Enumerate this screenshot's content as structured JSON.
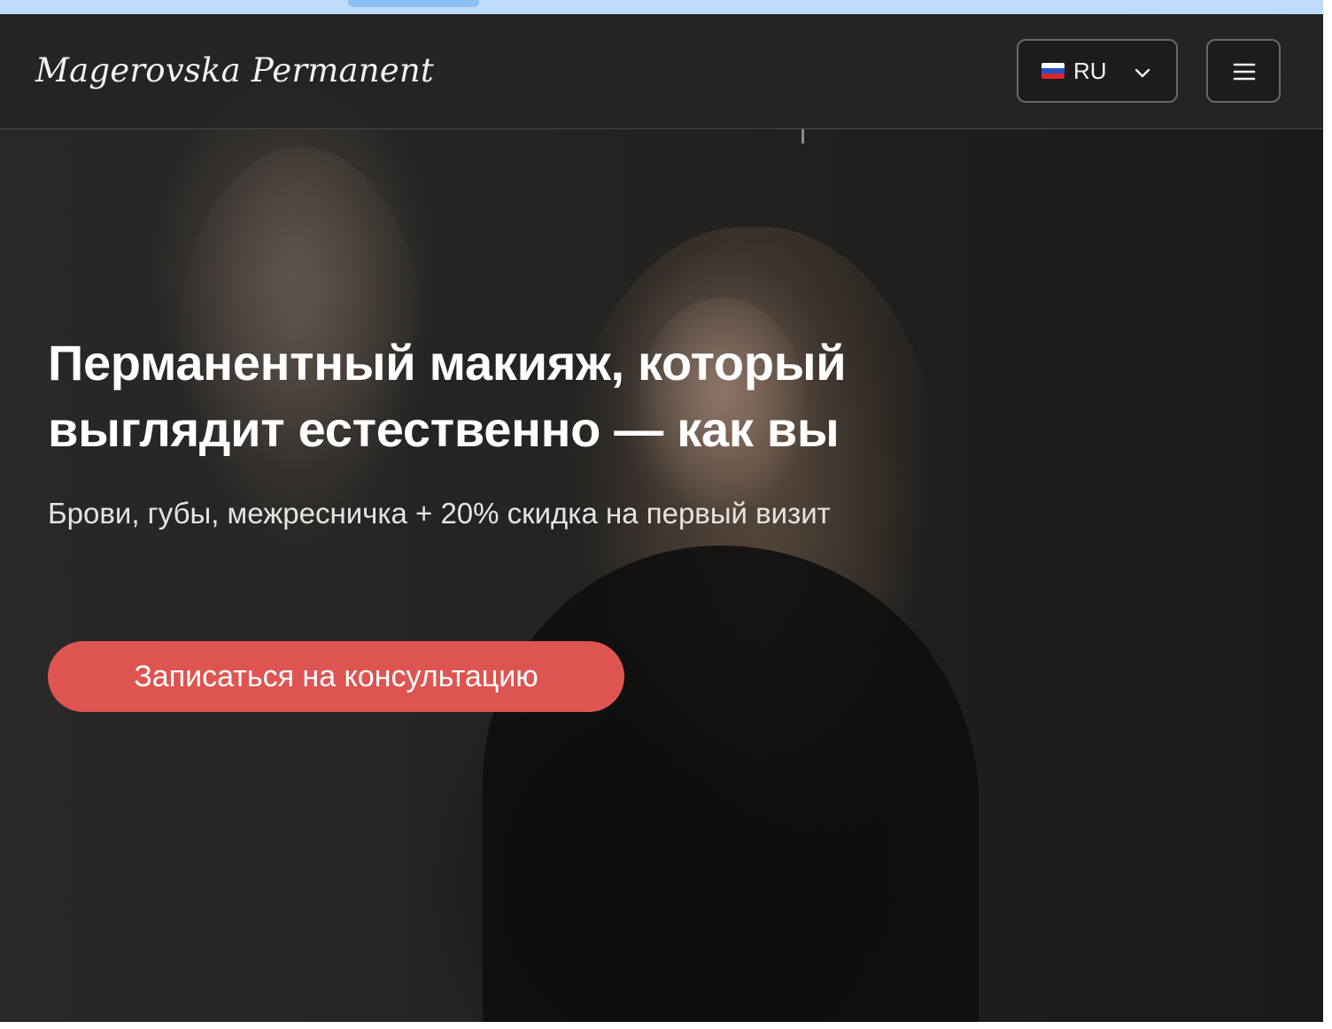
{
  "header": {
    "logo": "Magerovska Permanent",
    "language": {
      "flag_icon": "russia-flag-icon",
      "selected": "RU"
    },
    "menu_icon": "hamburger-menu-icon"
  },
  "hero": {
    "title_line1": "Перманентный макияж, который",
    "title_line2": "выглядит естественно — как вы",
    "subtitle": "Брови, губы, межресничка + 20% скидка на первый визит",
    "cta_label": "Записаться на консультацию"
  },
  "colors": {
    "page_background": "#1b1a19",
    "cta": "#de5451",
    "browser_strip": "#bfdcfb"
  }
}
